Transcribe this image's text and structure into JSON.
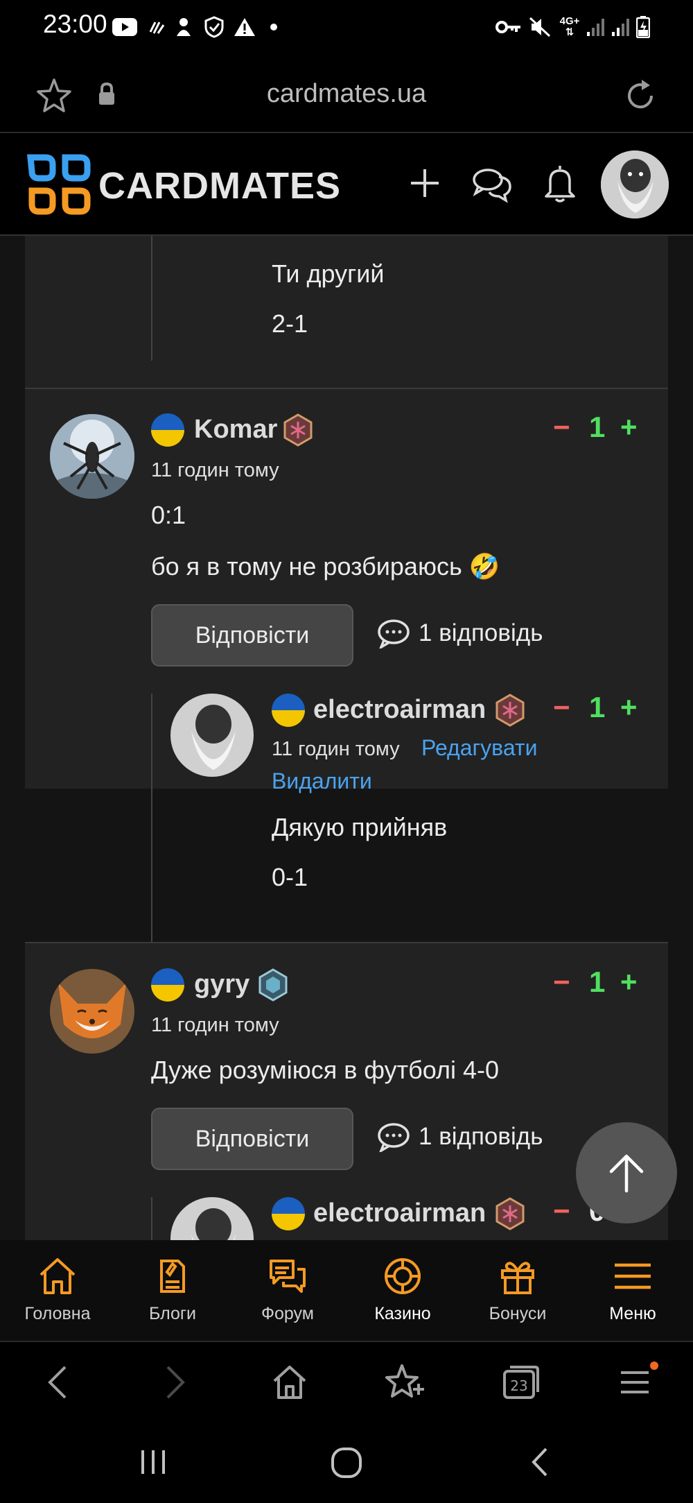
{
  "status_bar": {
    "time": "23:00"
  },
  "browser": {
    "url": "cardmates.ua"
  },
  "site": {
    "brand": "CARDMATES"
  },
  "comments": {
    "top_fragment": {
      "line1": "Ти другий",
      "line2": "2-1"
    },
    "komar": {
      "username": "Komar",
      "time": "11 годин тому",
      "vote_minus": "−",
      "votes": "1",
      "vote_plus": "+",
      "line1": "0:1",
      "line2": "бо я в тому не розбираюсь 🤣",
      "reply_label": "Відповісти",
      "replies_label": "1 відповідь",
      "reply": {
        "username": "electroairman",
        "time": "11 годин тому",
        "edit_label": "Редагувати",
        "delete_label": "Видалити",
        "vote_minus": "−",
        "votes": "1",
        "vote_plus": "+",
        "line1": "Дякую прийняв",
        "line2": "0-1"
      }
    },
    "gyry": {
      "username": "gyry",
      "time": "11 годин тому",
      "vote_minus": "−",
      "votes": "1",
      "vote_plus": "+",
      "line1": "Дуже розуміюся в футболі 4-0",
      "reply_label": "Відповісти",
      "replies_label": "1 відповідь",
      "reply": {
        "username": "electroairman",
        "vote_minus": "−",
        "votes": "0"
      }
    }
  },
  "site_nav": {
    "items": [
      {
        "label": "Головна",
        "icon": "home-icon"
      },
      {
        "label": "Блоги",
        "icon": "blog-icon"
      },
      {
        "label": "Форум",
        "icon": "forum-icon"
      },
      {
        "label": "Казино",
        "icon": "casino-icon"
      },
      {
        "label": "Бонуси",
        "icon": "gift-icon"
      },
      {
        "label": "Меню",
        "icon": "menu-icon"
      }
    ]
  },
  "colors": {
    "accent_orange": "#f59a23",
    "vote_minus": "#f0625f",
    "vote_plus": "#50e060",
    "link_blue": "#4aa3f0"
  }
}
